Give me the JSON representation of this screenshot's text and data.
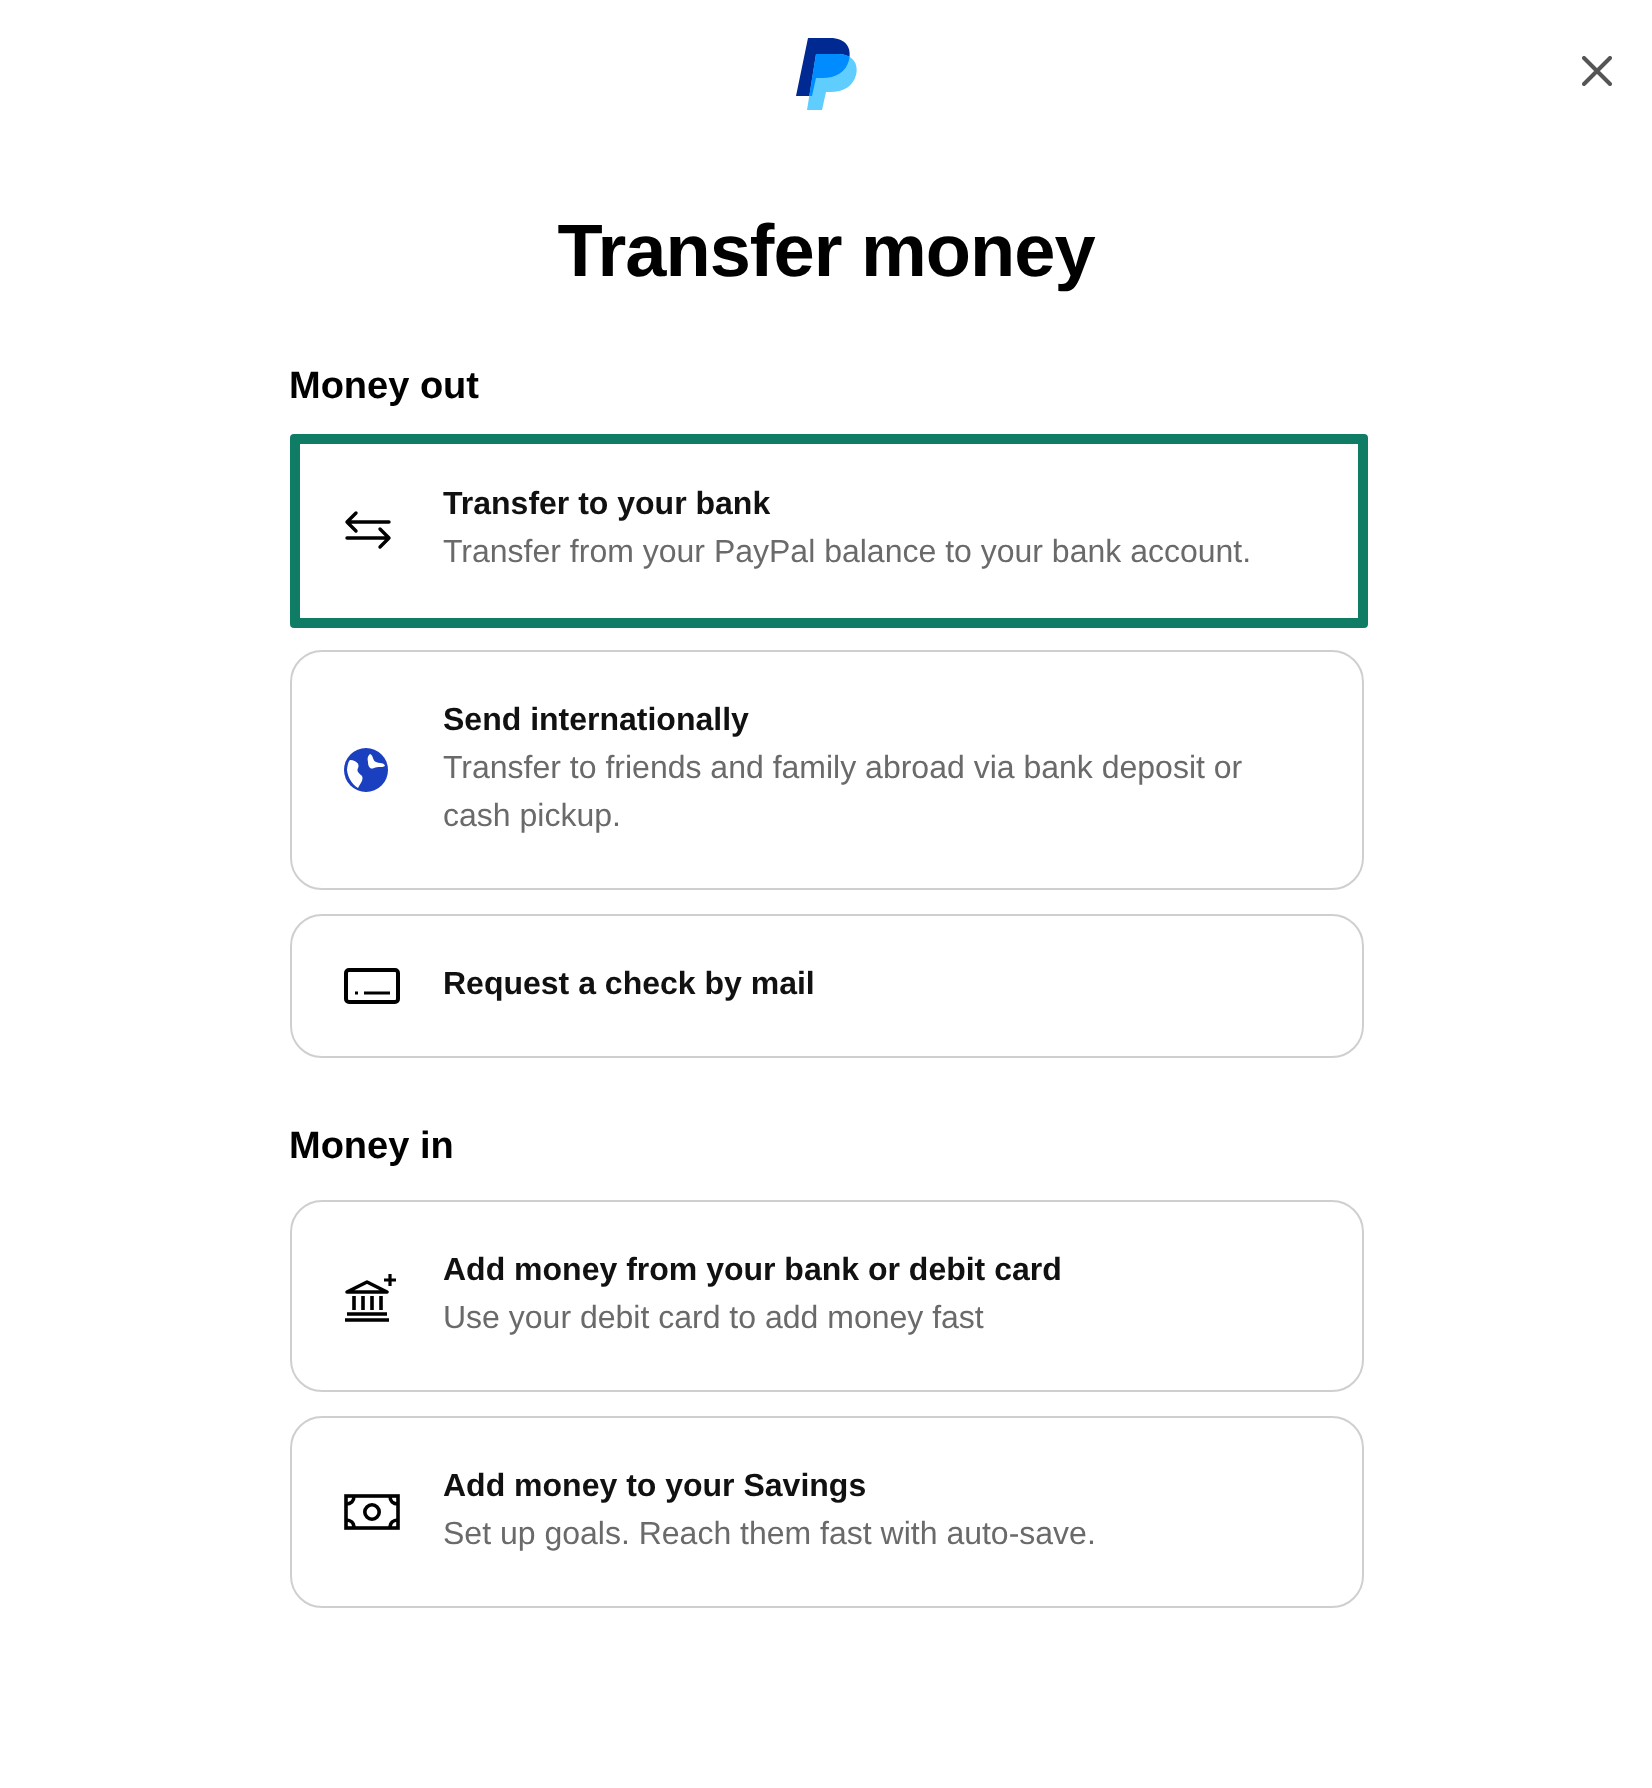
{
  "title": "Transfer money",
  "sections": [
    {
      "heading": "Money out",
      "options": [
        {
          "kind": "transfer",
          "title": "Transfer to your bank",
          "description": "Transfer from your PayPal balance to your bank account.",
          "selected": true
        },
        {
          "kind": "globe",
          "title": "Send internationally",
          "description": "Transfer to friends and family abroad via bank deposit or cash pickup.",
          "selected": false
        },
        {
          "kind": "check",
          "title": "Request a check by mail",
          "selected": false
        }
      ]
    },
    {
      "heading": "Money in",
      "options": [
        {
          "kind": "bank",
          "title": "Add money from your bank or debit card",
          "description": "Use your debit card to add money fast",
          "selected": false
        },
        {
          "kind": "savings",
          "title": "Add money to your Savings",
          "description": "Set up goals. Reach them fast with auto-save.",
          "selected": false
        }
      ]
    }
  ]
}
